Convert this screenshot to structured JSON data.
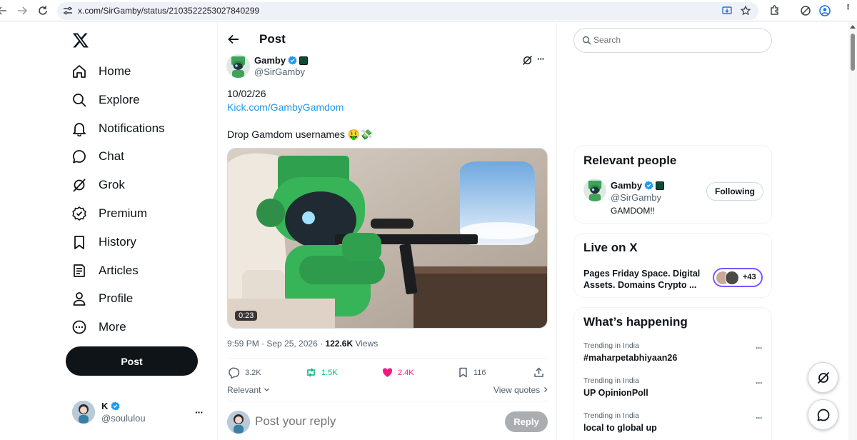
{
  "browser": {
    "url": "x.com/SirGamby/status/2103522253027840299",
    "icons": [
      "back-icon",
      "forward-icon",
      "reload-icon",
      "site-settings-icon",
      "install-app-icon",
      "bookmark-star-icon",
      "extensions-icon",
      "grok-extension-icon",
      "profile-icon"
    ]
  },
  "nav": {
    "items": [
      {
        "label": "Home",
        "icon": "home-icon"
      },
      {
        "label": "Explore",
        "icon": "search-icon"
      },
      {
        "label": "Notifications",
        "icon": "bell-icon"
      },
      {
        "label": "Chat",
        "icon": "chat-icon"
      },
      {
        "label": "Grok",
        "icon": "grok-icon"
      },
      {
        "label": "Premium",
        "icon": "premium-icon"
      },
      {
        "label": "History",
        "icon": "bookmark-icon"
      },
      {
        "label": "Articles",
        "icon": "articles-icon"
      },
      {
        "label": "Profile",
        "icon": "profile-icon"
      },
      {
        "label": "More",
        "icon": "more-icon"
      }
    ],
    "post_label": "Post"
  },
  "account": {
    "name": "K",
    "handle": "@soululou"
  },
  "header": {
    "title": "Post"
  },
  "tweet": {
    "author_name": "Gamby",
    "author_handle": "@SirGamby",
    "line1": "10/02/26",
    "link": "Kick.com/GambyGamdom",
    "line3": "Drop Gamdom usernames 🤑💸",
    "duration": "0:23",
    "time": "9:59 PM · Sep 25, 2026 · ",
    "views_count": "122.6K",
    "views_label": " Views",
    "replies": "3.2K",
    "reposts": "1.5K",
    "likes": "2.4K",
    "bookmarks": "116",
    "sort_label": "Relevant",
    "view_quotes": "View quotes"
  },
  "reply": {
    "placeholder": "Post your reply",
    "button": "Reply"
  },
  "search": {
    "placeholder": "Search"
  },
  "relevant_people": {
    "title": "Relevant people",
    "name": "Gamby",
    "handle": "@SirGamby",
    "bio": "GAMDOM!!",
    "follow_label": "Following"
  },
  "live": {
    "title": "Live on X",
    "text": "Pages Friday Space. Digital Assets. Domains Crypto ...",
    "count": "+43"
  },
  "happening": {
    "title": "What’s happening",
    "trends": [
      {
        "context": "Trending in India",
        "title": "#maharpetabhiyaan26"
      },
      {
        "context": "Trending in India",
        "title": "UP OpinionPoll"
      },
      {
        "context": "Trending in India",
        "title": "local to global up"
      }
    ]
  },
  "colors": {
    "accent": "#1d9bf0",
    "like": "#f91880",
    "repost": "#00ba7c",
    "text": "#0f1419",
    "muted": "#536471"
  }
}
